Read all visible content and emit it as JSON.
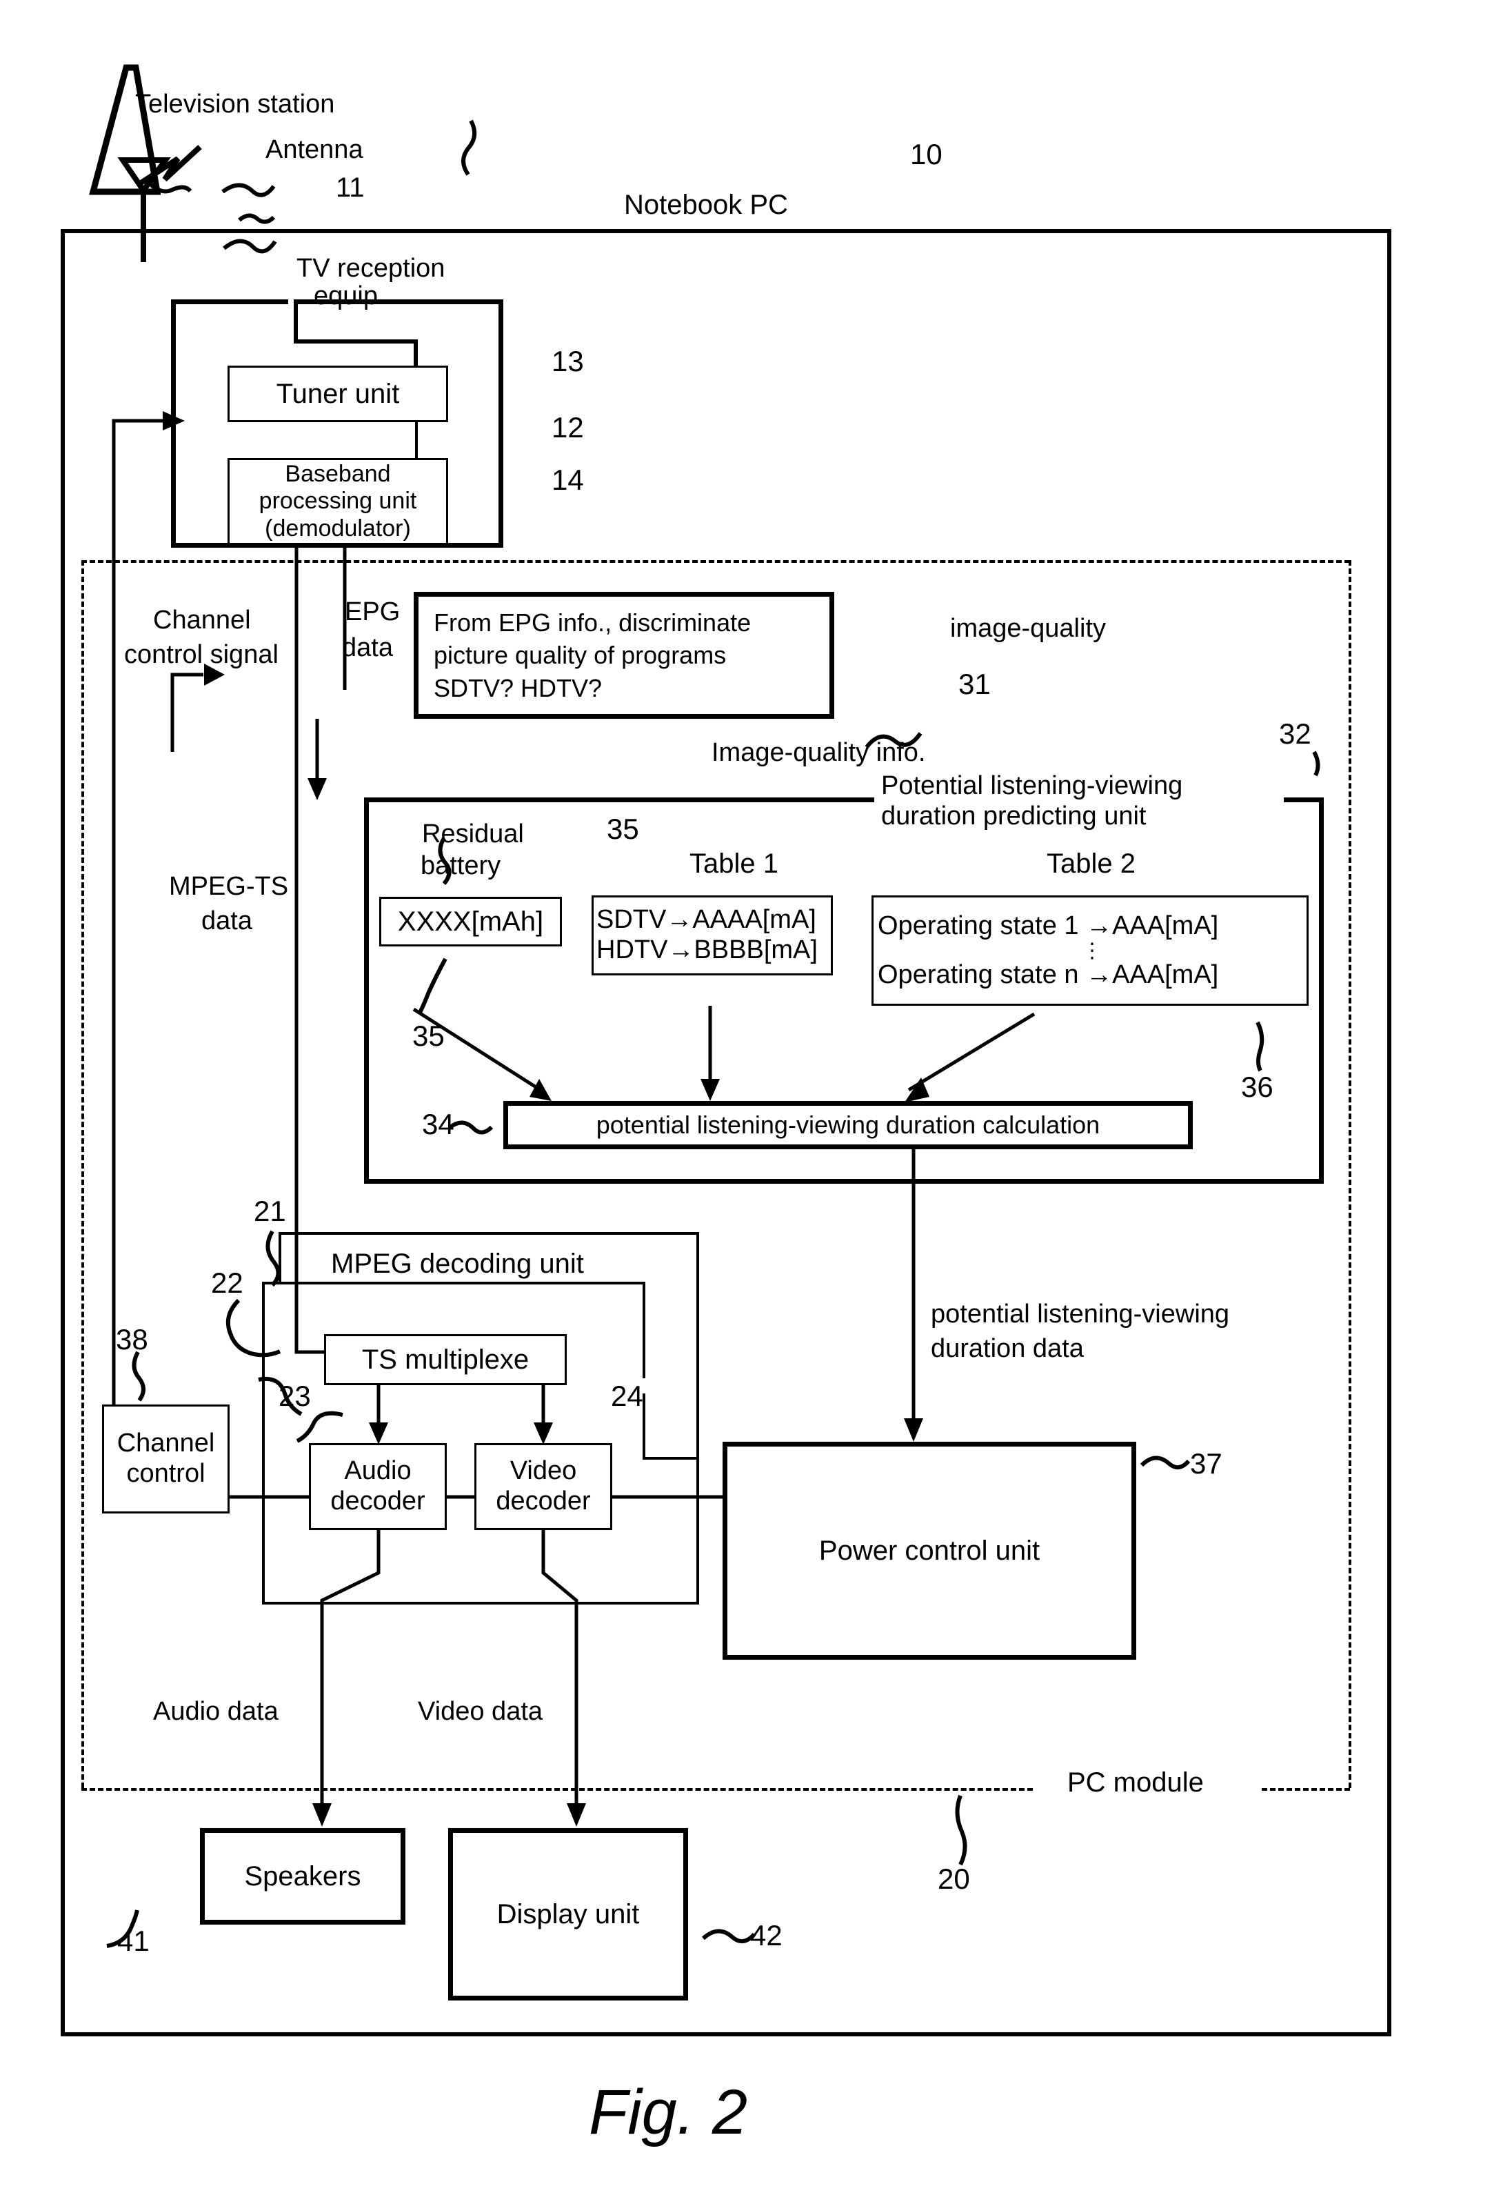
{
  "figure": {
    "caption": "Fig. 2"
  },
  "labels": {
    "television_station": "Television station",
    "antenna": "Antenna",
    "antenna_ref": "11",
    "notebook_pc": "Notebook PC",
    "notebook_pc_ref": "10",
    "tv_reception_line1": "TV reception",
    "tv_reception_line2": "equip.",
    "tuner_unit": "Tuner unit",
    "tuner_ref": "13",
    "baseband_line1": "Baseband",
    "baseband_line2": "processing unit",
    "baseband_line3": "(demodulator)",
    "tv_recv_ref": "12",
    "baseband_ref": "14",
    "channel_control_signal_line1": "Channel",
    "channel_control_signal_line2": "control signal",
    "epg_line1": "EPG",
    "epg_line2": "data",
    "epg_box_line1": "From EPG info., discriminate",
    "epg_box_line2": "picture quality of programs",
    "epg_box_line3": "SDTV?  HDTV?",
    "image_quality": "image-quality",
    "epg_ref": "31",
    "image_quality_info": "Image-quality info.",
    "predicting_unit_line1": "Potential listening-viewing",
    "predicting_unit_line2": "duration predicting unit",
    "predicting_unit_ref": "32",
    "mpeg_ts_line1": "MPEG-TS",
    "mpeg_ts_line2": "data",
    "residual_battery_line1": "Residual",
    "residual_battery_line2": "battery",
    "residual_value": "XXXX[mAh]",
    "residual_ref_top": "35",
    "residual_ref_bottom": "35",
    "table1_title": "Table 1",
    "table1_row1": "SDTV→AAAA[mA]",
    "table1_row2": "HDTV→BBBB[mA]",
    "table2_title": "Table 2",
    "table2_row1": "Operating state 1 →AAA[mA]",
    "table2_dots": "⋮",
    "table2_row2": "Operating state n →AAA[mA]",
    "table2_ref": "36",
    "calculation_box": "potential listening-viewing duration calculation",
    "calculation_ref": "34",
    "mpeg_decoding_unit": "MPEG decoding unit",
    "mpeg_decoding_ref": "21",
    "ts_multiplexer": "TS multiplexe",
    "ts_multiplexer_ref": "22",
    "audio_decoder_line1": "Audio",
    "audio_decoder_line2": "decoder",
    "audio_decoder_ref": "23",
    "video_decoder_line1": "Video",
    "video_decoder_line2": "decoder",
    "video_decoder_ref": "24",
    "channel_control_line1": "Channel",
    "channel_control_line2": "control",
    "channel_control_ref": "38",
    "duration_data_line1": "potential listening-viewing",
    "duration_data_line2": "duration data",
    "power_control_unit": "Power control unit",
    "power_control_ref": "37",
    "audio_data": "Audio data",
    "video_data": "Video data",
    "pc_module": "PC module",
    "pc_module_ref": "20",
    "speakers": "Speakers",
    "speakers_ref": "41",
    "display_unit": "Display unit",
    "display_unit_ref": "42"
  },
  "colors": {
    "ink": "#000000",
    "paper": "#ffffff"
  }
}
